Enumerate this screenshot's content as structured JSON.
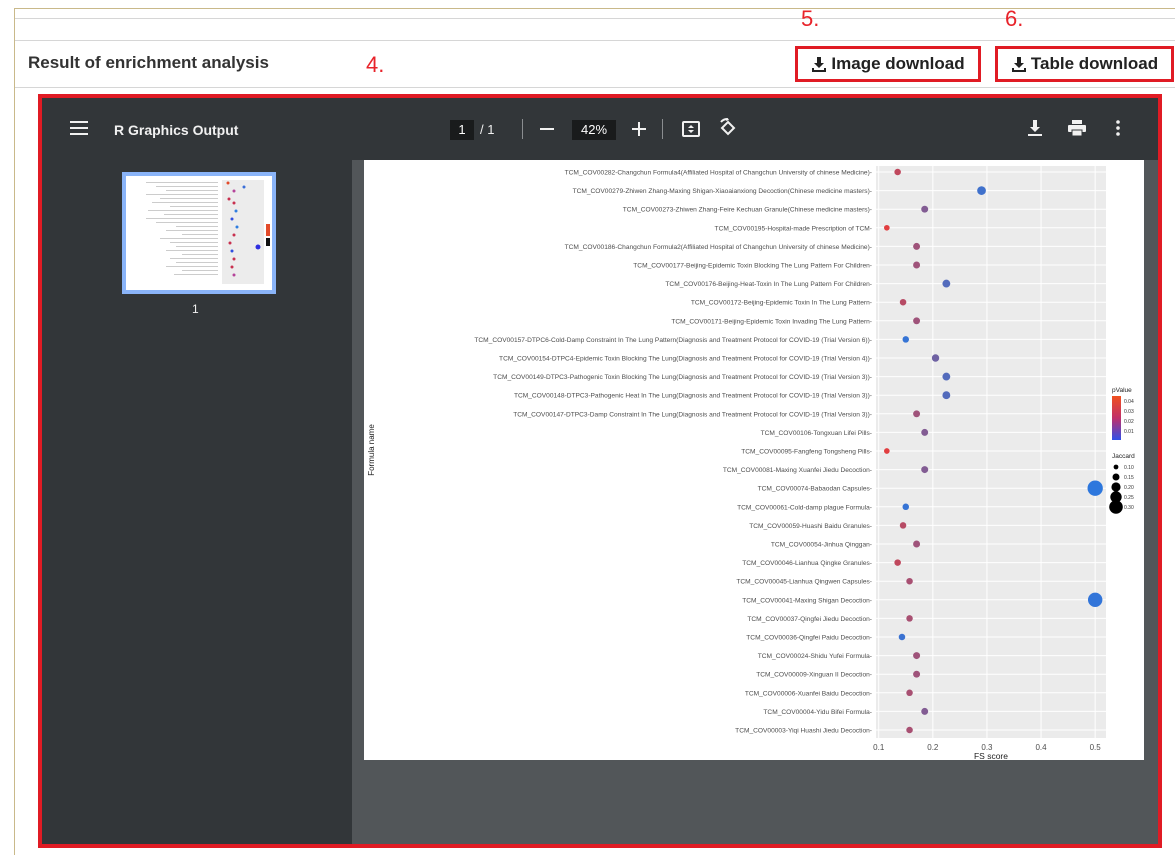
{
  "header": {
    "section_title": "Result of enrichment analysis",
    "image_download_label": "Image download",
    "table_download_label": "Table download"
  },
  "step_labels": {
    "step4": "4.",
    "step5": "5.",
    "step6": "6."
  },
  "viewer": {
    "title": "R Graphics Output",
    "current_page": "1",
    "page_separator": "/ 1",
    "zoom": "42%",
    "thumbnail_page": "1",
    "icons": [
      "menu-icon",
      "zoom-out-icon",
      "zoom-in-icon",
      "fit-page-icon",
      "rotate-icon",
      "download-icon",
      "print-icon",
      "more-icon"
    ]
  },
  "colors": {
    "accent_red": "#e01b24",
    "toolbar_bg": "#323639",
    "viewer_bg": "#525659",
    "plot_panel": "#ebebeb"
  },
  "chart_data": {
    "type": "scatter",
    "xlabel": "FS score",
    "ylabel": "Formula name",
    "xlim": [
      0.095,
      0.52
    ],
    "xticks": [
      0.1,
      0.2,
      0.3,
      0.4,
      0.5
    ],
    "x_tick_labels": [
      "0.1",
      "0.2",
      "0.3",
      "0.4",
      "0.5"
    ],
    "legend_color_title": "pValue",
    "legend_color_labels": [
      "0.04",
      "0.03",
      "0.02",
      "0.01"
    ],
    "legend_size_title": "Jaccard",
    "legend_size_labels": [
      "0.10",
      "0.15",
      "0.20",
      "0.25",
      "0.30"
    ],
    "legend_placement": "right",
    "grid": true,
    "points": [
      {
        "label": "TCM_COV00282-Changchun Formula4(Affiliated Hospital of Changchun University of chinese Medicine)",
        "x": 0.135,
        "p": 0.035,
        "j": 0.08
      },
      {
        "label": "TCM_COV00279-Zhiwen Zhang-Maxing Shigan-Xiaoaianxiong Decoction(Chinese medicine masters)",
        "x": 0.29,
        "p": 0.008,
        "j": 0.13
      },
      {
        "label": "TCM_COV00273-Zhiwen Zhang-Feire Kechuan Granule(Chinese medicine masters)",
        "x": 0.185,
        "p": 0.022,
        "j": 0.09
      },
      {
        "label": "TCM_COV00195-Hospital-made Prescription of TCM",
        "x": 0.115,
        "p": 0.042,
        "j": 0.06
      },
      {
        "label": "TCM_COV00186-Changchun Formula2(Affiliated Hospital of Changchun University of chinese Medicine)",
        "x": 0.17,
        "p": 0.028,
        "j": 0.09
      },
      {
        "label": "TCM_COV00177-Beijing-Epidemic Toxin Blocking The Lung Pattern For Children",
        "x": 0.17,
        "p": 0.028,
        "j": 0.09
      },
      {
        "label": "TCM_COV00176-Beijing-Heat-Toxin In The Lung Pattern For Children",
        "x": 0.225,
        "p": 0.012,
        "j": 0.11
      },
      {
        "label": "TCM_COV00172-Beijing-Epidemic Toxin In The Lung Pattern",
        "x": 0.145,
        "p": 0.033,
        "j": 0.08
      },
      {
        "label": "TCM_COV00171-Beijing-Epidemic Toxin Invading The Lung Pattern",
        "x": 0.17,
        "p": 0.028,
        "j": 0.09
      },
      {
        "label": "TCM_COV00157-DTPC6-Cold-Damp Constraint In The Lung Pattern(Diagnosis and Treatment Protocol for COVID-19 (Trial Version 6))",
        "x": 0.15,
        "p": 0.006,
        "j": 0.08
      },
      {
        "label": "TCM_COV00154-DTPC4-Epidemic Toxin Blocking The Lung(Diagnosis and Treatment Protocol for COVID-19 (Trial Version 4))",
        "x": 0.205,
        "p": 0.018,
        "j": 0.1
      },
      {
        "label": "TCM_COV00149-DTPC3-Pathogenic Toxin Blocking The Lung(Diagnosis and Treatment Protocol for COVID-19 (Trial Version 3))",
        "x": 0.225,
        "p": 0.012,
        "j": 0.11
      },
      {
        "label": "TCM_COV00148-DTPC3-Pathogenic Heat In The Lung(Diagnosis and Treatment Protocol for COVID-19 (Trial Version 3))",
        "x": 0.225,
        "p": 0.012,
        "j": 0.11
      },
      {
        "label": "TCM_COV00147-DTPC3-Damp Constraint In The Lung(Diagnosis and Treatment Protocol for COVID-19 (Trial Version 3))",
        "x": 0.17,
        "p": 0.028,
        "j": 0.09
      },
      {
        "label": "TCM_COV00106-Tongxuan Lifei Pills",
        "x": 0.185,
        "p": 0.022,
        "j": 0.09
      },
      {
        "label": "TCM_COV00095-Fangfeng Tongsheng Pills",
        "x": 0.115,
        "p": 0.042,
        "j": 0.06
      },
      {
        "label": "TCM_COV00081-Maxing Xuanfei Jiedu Decoction",
        "x": 0.185,
        "p": 0.022,
        "j": 0.09
      },
      {
        "label": "TCM_COV00074-Babaodan Capsules",
        "x": 0.5,
        "p": 0.004,
        "j": 0.28
      },
      {
        "label": "TCM_COV00061-Cold-damp plague Formula",
        "x": 0.15,
        "p": 0.006,
        "j": 0.08
      },
      {
        "label": "TCM_COV00059-Huashi Baidu Granules",
        "x": 0.145,
        "p": 0.033,
        "j": 0.08
      },
      {
        "label": "TCM_COV00054-Jinhua Qinggan",
        "x": 0.17,
        "p": 0.028,
        "j": 0.09
      },
      {
        "label": "TCM_COV00046-Lianhua Qingke Granules",
        "x": 0.135,
        "p": 0.035,
        "j": 0.08
      },
      {
        "label": "TCM_COV00045-Lianhua Qingwen Capsules",
        "x": 0.157,
        "p": 0.03,
        "j": 0.08
      },
      {
        "label": "TCM_COV00041-Maxing Shigan Decoction",
        "x": 0.5,
        "p": 0.005,
        "j": 0.26
      },
      {
        "label": "TCM_COV00037-Qingfei Jiedu Decoction",
        "x": 0.157,
        "p": 0.03,
        "j": 0.08
      },
      {
        "label": "TCM_COV00036-Qingfei Paidu Decoction",
        "x": 0.143,
        "p": 0.007,
        "j": 0.08
      },
      {
        "label": "TCM_COV00024-Shidu Yufei Formula",
        "x": 0.17,
        "p": 0.028,
        "j": 0.09
      },
      {
        "label": "TCM_COV00009-Xinguan II Decoction",
        "x": 0.17,
        "p": 0.028,
        "j": 0.09
      },
      {
        "label": "TCM_COV00006-Xuanfei Baidu Decoction",
        "x": 0.157,
        "p": 0.03,
        "j": 0.08
      },
      {
        "label": "TCM_COV00004-Yidu Bifei Formula",
        "x": 0.185,
        "p": 0.022,
        "j": 0.09
      },
      {
        "label": "TCM_COV00003-Yiqi Huashi Jiedu Decoction",
        "x": 0.157,
        "p": 0.03,
        "j": 0.08
      }
    ]
  }
}
